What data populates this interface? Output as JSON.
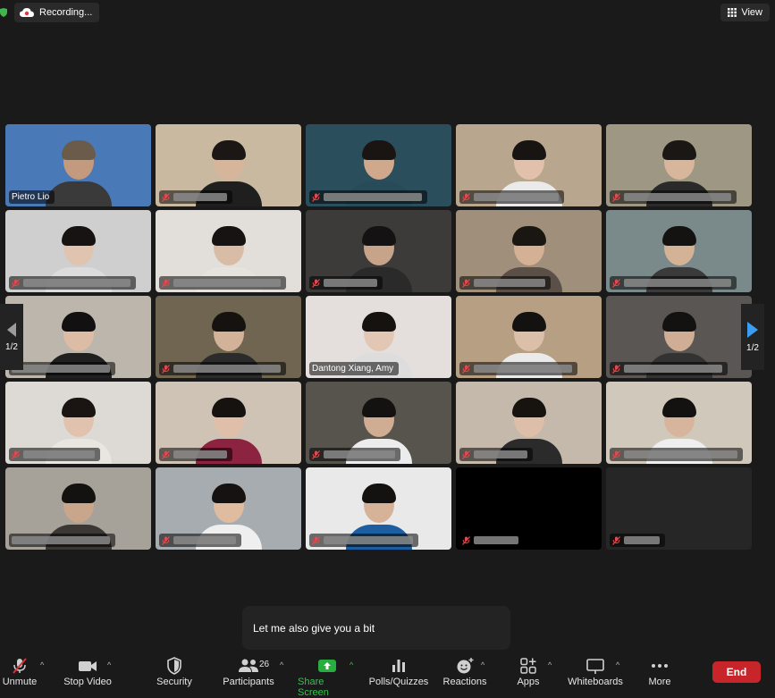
{
  "recording": {
    "label": "Recording..."
  },
  "view_button": {
    "label": "View"
  },
  "pagination": {
    "left": "1/2",
    "right": "1/2"
  },
  "participants_tiles": [
    {
      "name": "Pietro Lio",
      "active_speaker": true,
      "muted": false,
      "bg": "#4a79b8",
      "skin": "#c49a7e",
      "hair": "#6b5b4a",
      "shirt": "#3a3a3a"
    },
    {
      "name": "",
      "muted": true,
      "bg": "#c9b9a0",
      "skin": "#d7b59b",
      "hair": "#1c1714",
      "shirt": "#1f1f1f",
      "blur_width": 60
    },
    {
      "name": "",
      "muted": true,
      "bg": "#2b4e5c",
      "skin": "#d0a88c",
      "hair": "#1a1512",
      "shirt": "#274b59",
      "blur_width": 110
    },
    {
      "name": "",
      "muted": true,
      "bg": "#b8a78e",
      "skin": "#e1c1ab",
      "hair": "#181412",
      "shirt": "#eaeaea",
      "blur_width": 95
    },
    {
      "name": "",
      "muted": true,
      "bg": "#9e9784",
      "skin": "#d8b69b",
      "hair": "#1a1714",
      "shirt": "#2a2a2a",
      "blur_width": 120
    },
    {
      "name": "",
      "muted": true,
      "bg": "#cfcfcf",
      "skin": "#e0c4b0",
      "hair": "#161312",
      "shirt": "#dcdcdc",
      "blur_width": 120
    },
    {
      "name": "",
      "muted": true,
      "bg": "#e2dfdb",
      "skin": "#d9bca6",
      "hair": "#161312",
      "shirt": "#e6e3df",
      "blur_width": 120
    },
    {
      "name": "",
      "muted": true,
      "bg": "#3c3b3a",
      "skin": "#c7a38a",
      "hair": "#141212",
      "shirt": "#2a2a2a",
      "blur_width": 60
    },
    {
      "name": "",
      "muted": true,
      "bg": "#a0907b",
      "skin": "#d4b095",
      "hair": "#1a1612",
      "shirt": "#5a5048",
      "blur_width": 80
    },
    {
      "name": "",
      "muted": true,
      "bg": "#7a8a8a",
      "skin": "#d3b296",
      "hair": "#151312",
      "shirt": "#3a3a3a",
      "blur_width": 120
    },
    {
      "name": "",
      "muted": false,
      "bg": "#bcb6ad",
      "skin": "#dcbca5",
      "hair": "#121010",
      "shirt": "#202020",
      "blur_width": 110
    },
    {
      "name": "",
      "muted": true,
      "bg": "#6f6550",
      "skin": "#d2b299",
      "hair": "#151210",
      "shirt": "#2b2b2b",
      "blur_width": 120
    },
    {
      "name": "Dantong Xiang, Amy",
      "muted": false,
      "bg": "#e4dfdc",
      "skin": "#e2c7b5",
      "hair": "#151210",
      "shirt": "#dddddd"
    },
    {
      "name": "",
      "muted": true,
      "bg": "#b69f83",
      "skin": "#dcbfa8",
      "hair": "#141210",
      "shirt": "#eaeaea",
      "blur_width": 110
    },
    {
      "name": "",
      "muted": true,
      "bg": "#595653",
      "skin": "#d0ad95",
      "hair": "#141210",
      "shirt": "#333333",
      "blur_width": 110
    },
    {
      "name": "",
      "muted": true,
      "bg": "#dddad6",
      "skin": "#e0c2ae",
      "hair": "#1a1512",
      "shirt": "#e9e6e2",
      "blur_width": 80
    },
    {
      "name": "",
      "muted": true,
      "bg": "#cfc3b6",
      "skin": "#dfbfaa",
      "hair": "#161210",
      "shirt": "#8c2340",
      "blur_width": 60
    },
    {
      "name": "",
      "muted": true,
      "bg": "#57544e",
      "skin": "#d0ac92",
      "hair": "#141210",
      "shirt": "#ececec",
      "blur_width": 80
    },
    {
      "name": "",
      "muted": true,
      "bg": "#c4b9ab",
      "skin": "#ddbea8",
      "hair": "#17130f",
      "shirt": "#2b2b2b",
      "blur_width": 60
    },
    {
      "name": "",
      "muted": true,
      "bg": "#d1c8bc",
      "skin": "#d7b59c",
      "hair": "#141210",
      "shirt": "#eeeeee",
      "blur_width": 130
    },
    {
      "name": "",
      "muted": false,
      "bg": "#a6a199",
      "skin": "#c9a58c",
      "hair": "#141210",
      "shirt": "#3a3734",
      "blur_width": 110
    },
    {
      "name": "",
      "muted": true,
      "bg": "#a7acb0",
      "skin": "#dfbb9f",
      "hair": "#161210",
      "shirt": "#efefef",
      "blur_width": 70
    },
    {
      "name": "",
      "muted": true,
      "bg": "#e9e9e9",
      "skin": "#d5b298",
      "hair": "#141210",
      "shirt": "#1d5ea0",
      "blur_width": 100
    },
    {
      "name": "",
      "muted": true,
      "video_off": true,
      "bg": "#000000",
      "blur_width": 50
    },
    {
      "name": "",
      "muted": true,
      "video_off": true,
      "bg": "#262626",
      "blur_width": 40
    }
  ],
  "caption": {
    "text": "Let me also give you a bit"
  },
  "toolbar": {
    "unmute": "Unmute",
    "stop_video": "Stop Video",
    "security": "Security",
    "participants": "Participants",
    "participants_count": "26",
    "share_screen": "Share Screen",
    "polls": "Polls/Quizzes",
    "reactions": "Reactions",
    "apps": "Apps",
    "whiteboards": "Whiteboards",
    "more": "More",
    "end": "End"
  },
  "colors": {
    "share_green": "#27ae3e",
    "end_red": "#c7252a",
    "active_border": "#47b54b",
    "mute_red": "#d9323b"
  }
}
